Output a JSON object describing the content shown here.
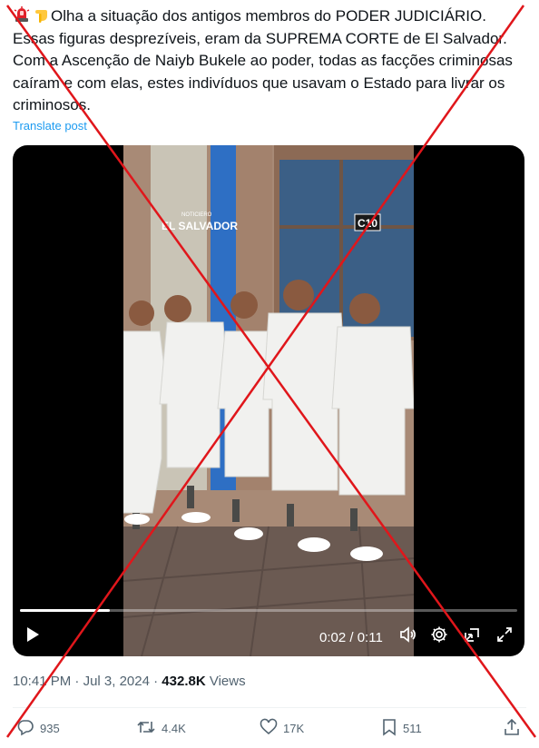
{
  "tweet": {
    "text": "Olha a situação dos antigos membros do PODER JUDICIÁRIO.\nEssas figuras desprezíveis, eram da SUPREMA CORTE de El Salvador.\nCom a Ascenção de Naiyb Bukele ao poder, todas as facções criminosas caíram e com elas, estes indivíduos que usavam o Estado para livrar os criminosos.",
    "emoji_icons": [
      "police-light-icon",
      "pointing-down-icon"
    ],
    "translate_label": "Translate post"
  },
  "video": {
    "watermark_small": "NOTICIERO",
    "watermark": "EL SALVADOR",
    "channel_logo": "C10",
    "time_current": "0:02",
    "time_separator": "/",
    "time_total": "0:11",
    "progress": 0.18,
    "controls": [
      "play-icon",
      "volume-icon",
      "settings-icon",
      "picture-in-picture-icon",
      "fullscreen-icon"
    ]
  },
  "meta": {
    "time": "10:41 PM",
    "separator": "·",
    "date": "Jul 3, 2024",
    "separator2": "·",
    "views_count": "432.8K",
    "views_label": "Views"
  },
  "actions": {
    "replies": "935",
    "reposts": "4.4K",
    "likes": "17K",
    "bookmarks": "511"
  },
  "colors": {
    "link": "#1d9bf0",
    "secondary_text": "#536471",
    "overlay_cross": "#e0161b"
  }
}
